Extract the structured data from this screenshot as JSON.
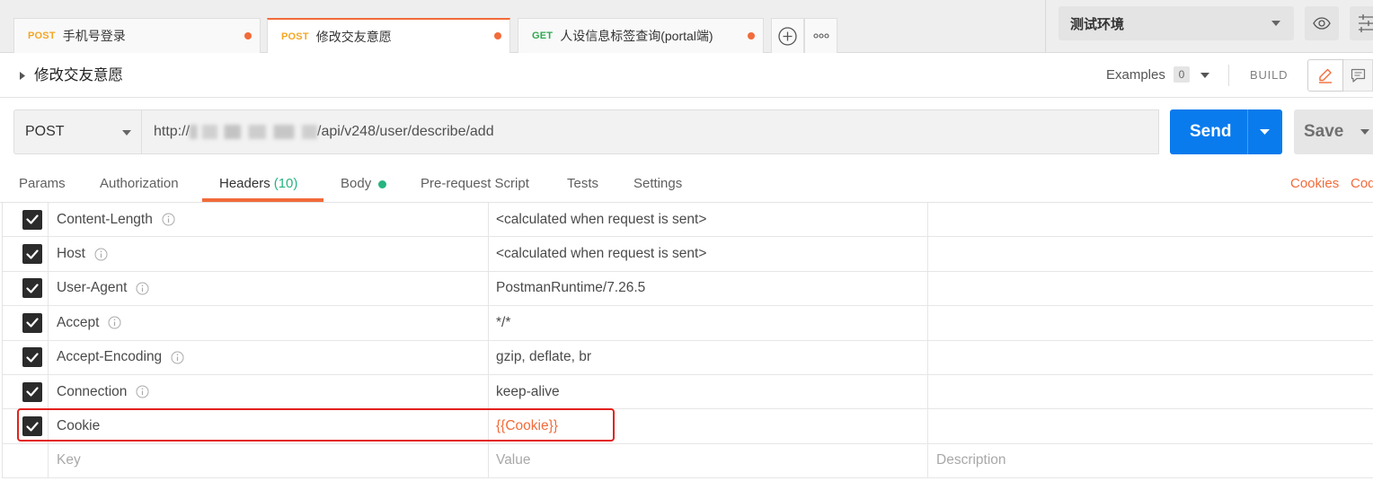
{
  "colors": {
    "accent": "#f26b3a",
    "post_method": "#f5a623",
    "get_method": "#2fa850",
    "send_button": "#097bed",
    "headers_count": "#26b47f",
    "highlight_box": "#e3211d"
  },
  "tabs": [
    {
      "method": "POST",
      "name": "手机号登录",
      "icon": "unsaved-dot-icon"
    },
    {
      "method": "POST",
      "name": "修改交友意愿",
      "active": true,
      "icon": "unsaved-dot-icon"
    },
    {
      "method": "GET",
      "name": "人设信息标签查询(portal端)",
      "icon": "unsaved-dot-icon"
    }
  ],
  "tab_actions": {
    "new_tab_icon": "plus-circle-icon",
    "more_icon": "more-horizontal-icon"
  },
  "environment": {
    "selected": "测试环境",
    "dropdown_icon": "chevron-down-icon",
    "quick_look_icon": "eye-icon",
    "settings_icon": "sliders-icon"
  },
  "request": {
    "expand_icon": "caret-right-icon",
    "name": "修改交友意愿",
    "examples_label": "Examples",
    "examples_count": "0",
    "build_label": "BUILD",
    "edit_icon": "pencil-icon",
    "comments_icon": "comment-icon",
    "method": "POST",
    "url_prefix": "http://",
    "url_suffix": "/api/v248/user/describe/add",
    "send_label": "Send",
    "save_label": "Save"
  },
  "subtabs": [
    {
      "label": "Params"
    },
    {
      "label": "Authorization"
    },
    {
      "label": "Headers",
      "count": "(10)",
      "active": true
    },
    {
      "label": "Body",
      "icon": "status-dot-icon"
    },
    {
      "label": "Pre-request Script"
    },
    {
      "label": "Tests"
    },
    {
      "label": "Settings"
    }
  ],
  "links": {
    "cookies": "Cookies",
    "code": "Code"
  },
  "headers": {
    "rows": [
      {
        "checked": true,
        "key": "Content-Length",
        "icon": "info-icon",
        "value": "<calculated when request is sent>"
      },
      {
        "checked": true,
        "key": "Host",
        "icon": "info-icon",
        "value": "<calculated when request is sent>"
      },
      {
        "checked": true,
        "key": "User-Agent",
        "icon": "info-icon",
        "value": "PostmanRuntime/7.26.5"
      },
      {
        "checked": true,
        "key": "Accept",
        "icon": "info-icon",
        "value": "*/*"
      },
      {
        "checked": true,
        "key": "Accept-Encoding",
        "icon": "info-icon",
        "value": "gzip, deflate, br"
      },
      {
        "checked": true,
        "key": "Connection",
        "icon": "info-icon",
        "value": "keep-alive"
      },
      {
        "checked": true,
        "key": "Cookie",
        "value": "{{Cookie}}"
      }
    ],
    "placeholder": {
      "key": "Key",
      "value": "Value",
      "description": "Description"
    }
  }
}
